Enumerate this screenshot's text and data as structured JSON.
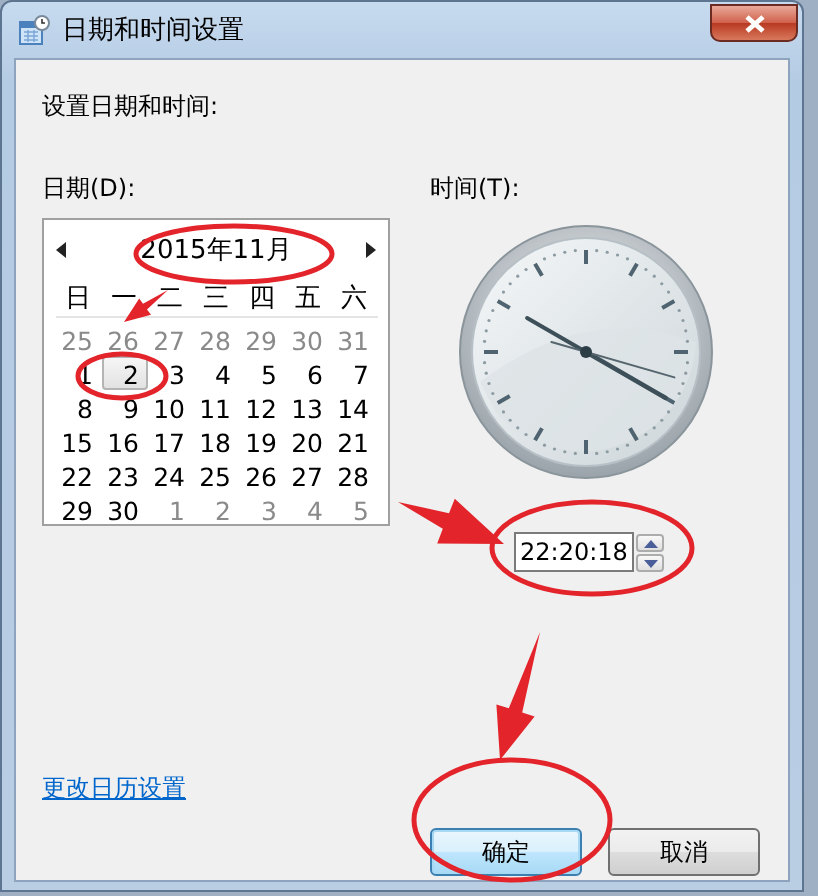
{
  "window": {
    "title": "日期和时间设置"
  },
  "heading": "设置日期和时间:",
  "date_label": "日期(D):",
  "time_label": "时间(T):",
  "calendar": {
    "month": "2015年11月",
    "weekdays": [
      "日",
      "一",
      "二",
      "三",
      "四",
      "五",
      "六"
    ],
    "weeks": [
      [
        {
          "day": "25",
          "other_month": true,
          "selected": false
        },
        {
          "day": "26",
          "other_month": true,
          "selected": false
        },
        {
          "day": "27",
          "other_month": true,
          "selected": false
        },
        {
          "day": "28",
          "other_month": true,
          "selected": false
        },
        {
          "day": "29",
          "other_month": true,
          "selected": false
        },
        {
          "day": "30",
          "other_month": true,
          "selected": false
        },
        {
          "day": "31",
          "other_month": true,
          "selected": false
        }
      ],
      [
        {
          "day": "1",
          "other_month": false,
          "selected": false
        },
        {
          "day": "2",
          "other_month": false,
          "selected": true
        },
        {
          "day": "3",
          "other_month": false,
          "selected": false
        },
        {
          "day": "4",
          "other_month": false,
          "selected": false
        },
        {
          "day": "5",
          "other_month": false,
          "selected": false
        },
        {
          "day": "6",
          "other_month": false,
          "selected": false
        },
        {
          "day": "7",
          "other_month": false,
          "selected": false
        }
      ],
      [
        {
          "day": "8",
          "other_month": false,
          "selected": false
        },
        {
          "day": "9",
          "other_month": false,
          "selected": false
        },
        {
          "day": "10",
          "other_month": false,
          "selected": false
        },
        {
          "day": "11",
          "other_month": false,
          "selected": false
        },
        {
          "day": "12",
          "other_month": false,
          "selected": false
        },
        {
          "day": "13",
          "other_month": false,
          "selected": false
        },
        {
          "day": "14",
          "other_month": false,
          "selected": false
        }
      ],
      [
        {
          "day": "15",
          "other_month": false,
          "selected": false
        },
        {
          "day": "16",
          "other_month": false,
          "selected": false
        },
        {
          "day": "17",
          "other_month": false,
          "selected": false
        },
        {
          "day": "18",
          "other_month": false,
          "selected": false
        },
        {
          "day": "19",
          "other_month": false,
          "selected": false
        },
        {
          "day": "20",
          "other_month": false,
          "selected": false
        },
        {
          "day": "21",
          "other_month": false,
          "selected": false
        }
      ],
      [
        {
          "day": "22",
          "other_month": false,
          "selected": false
        },
        {
          "day": "23",
          "other_month": false,
          "selected": false
        },
        {
          "day": "24",
          "other_month": false,
          "selected": false
        },
        {
          "day": "25",
          "other_month": false,
          "selected": false
        },
        {
          "day": "26",
          "other_month": false,
          "selected": false
        },
        {
          "day": "27",
          "other_month": false,
          "selected": false
        },
        {
          "day": "28",
          "other_month": false,
          "selected": false
        }
      ],
      [
        {
          "day": "29",
          "other_month": false,
          "selected": false
        },
        {
          "day": "30",
          "other_month": false,
          "selected": false
        },
        {
          "day": "1",
          "other_month": true,
          "selected": false
        },
        {
          "day": "2",
          "other_month": true,
          "selected": false
        },
        {
          "day": "3",
          "other_month": true,
          "selected": false
        },
        {
          "day": "4",
          "other_month": true,
          "selected": false
        },
        {
          "day": "5",
          "other_month": true,
          "selected": false
        }
      ]
    ]
  },
  "time": {
    "value": "22:20:18"
  },
  "link": "更改日历设置",
  "buttons": [
    {
      "label": "确定",
      "default": true
    },
    {
      "label": "取消",
      "default": false
    }
  ],
  "annotations": [
    {
      "kind": "ellipse"
    },
    {
      "kind": "ellipse"
    },
    {
      "kind": "ellipse"
    },
    {
      "kind": "ellipse"
    },
    {
      "kind": "arrow"
    },
    {
      "kind": "arrow"
    },
    {
      "kind": "arrow"
    }
  ]
}
